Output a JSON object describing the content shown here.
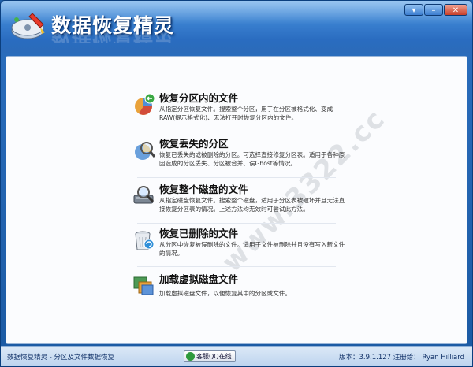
{
  "window": {
    "title": "数据恢复精灵",
    "controls": [
      "▾",
      "–",
      "✕"
    ]
  },
  "icons": {
    "logo": "disk-wizard-logo-icon",
    "item1": "recover-partition-files-icon",
    "item2": "recover-lost-partition-icon",
    "item3": "recover-whole-disk-icon",
    "item4": "recover-deleted-files-icon",
    "item5": "load-virtual-disk-icon"
  },
  "items": [
    {
      "title": "恢复分区内的文件",
      "desc": "从指定分区恢复文件。搜索整个分区，用于在分区被格式化、变成RAW(提示格式化)、无法打开时恢复分区内的文件。"
    },
    {
      "title": "恢复丢失的分区",
      "desc": "恢复已丢失的或被删除的分区。可选择直接修复分区表。适用于各种原因造成的分区丢失、分区被合并、误Ghost等情况。"
    },
    {
      "title": "恢复整个磁盘的文件",
      "desc": "从指定磁盘恢复文件。搜索整个磁盘，适用于分区表被破坏并且无法直接恢复分区表的情况。上述方法均无效时可尝试此方法。"
    },
    {
      "title": "恢复已删除的文件",
      "desc": "从分区中恢复被误删除的文件。适用于文件被删除并且没有写入新文件的情况。"
    },
    {
      "title": "加载虚拟磁盘文件",
      "desc": "加载虚拟磁盘文件，以便恢复其中的分区或文件。"
    }
  ],
  "watermark": "www.3322.cc",
  "statusbar": {
    "app_desc": "数据恢复精灵 - 分区及文件数据恢复",
    "qq_label": "客服QQ在线",
    "version": "版本：3.9.1.127 注册给： Ryan Hilliard"
  }
}
